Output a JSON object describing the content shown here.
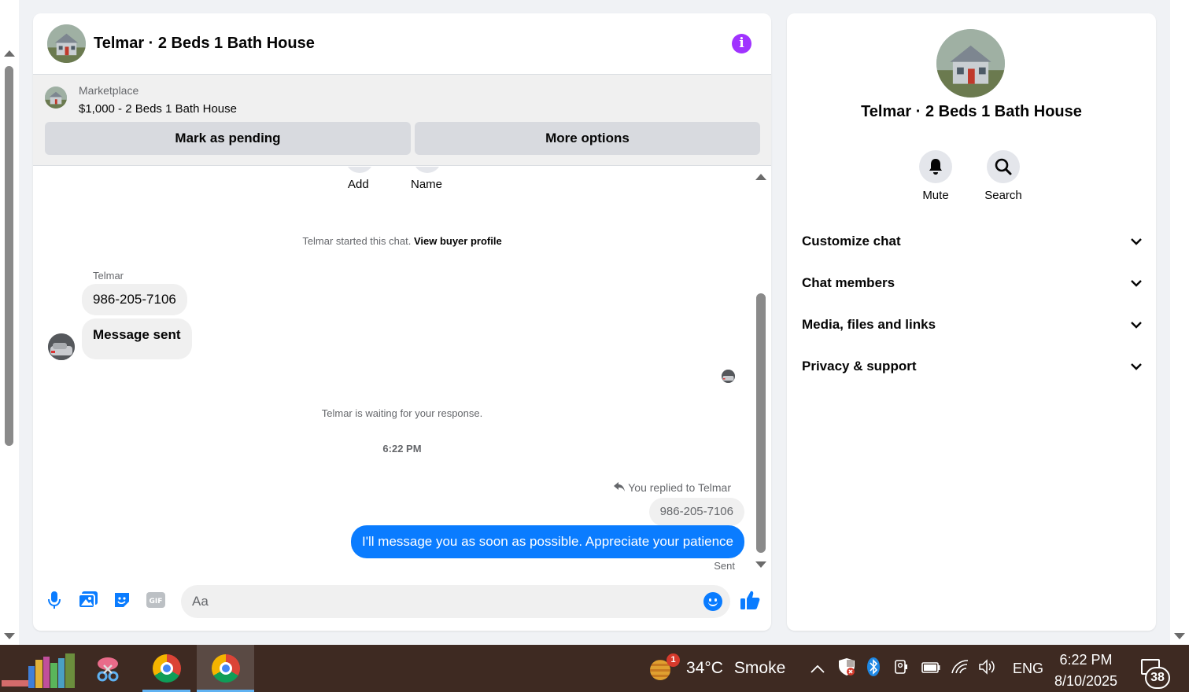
{
  "chat": {
    "title": "Telmar · 2 Beds 1 Bath House",
    "info_icon": "info-icon",
    "marketplace": {
      "label": "Marketplace",
      "listing": "$1,000 - 2 Beds 1 Bath House",
      "pending_button": "Mark as pending",
      "more_button": "More options"
    },
    "quick_actions": [
      {
        "label": "Add"
      },
      {
        "label": "Name"
      }
    ],
    "started_text": "Telmar started this chat.",
    "buyer_profile_link": "View buyer profile",
    "sender_name": "Telmar",
    "incoming": [
      "986-205-7106",
      "Message sent"
    ],
    "waiting_text": "Telmar is waiting for your response.",
    "timestamp": "6:22 PM",
    "replied_text": "You replied to Telmar",
    "quoted_text": "986-205-7106",
    "outgoing": "I'll message you as soon as possible. Appreciate your patience",
    "sent_status": "Sent",
    "composer_placeholder": "Aa",
    "composer_icons": [
      "microphone-icon",
      "image-icon",
      "sticker-icon",
      "gif-icon",
      "emoji-icon",
      "thumbs-up-icon"
    ]
  },
  "info_panel": {
    "title": "Telmar · 2 Beds 1 Bath House",
    "actions": [
      {
        "label": "Mute",
        "icon": "bell-icon"
      },
      {
        "label": "Search",
        "icon": "search-icon"
      }
    ],
    "sections": [
      "Customize chat",
      "Chat members",
      "Media, files and links",
      "Privacy & support"
    ]
  },
  "taskbar": {
    "weather_badge": "1",
    "temperature": "34°C",
    "condition": "Smoke",
    "language": "ENG",
    "time": "6:22 PM",
    "date": "8/10/2025",
    "notification_count": "38"
  },
  "colors": {
    "accent_blue": "#0a7cff",
    "info_purple": "#a033ff",
    "taskbar_bg": "#3e2a22"
  }
}
